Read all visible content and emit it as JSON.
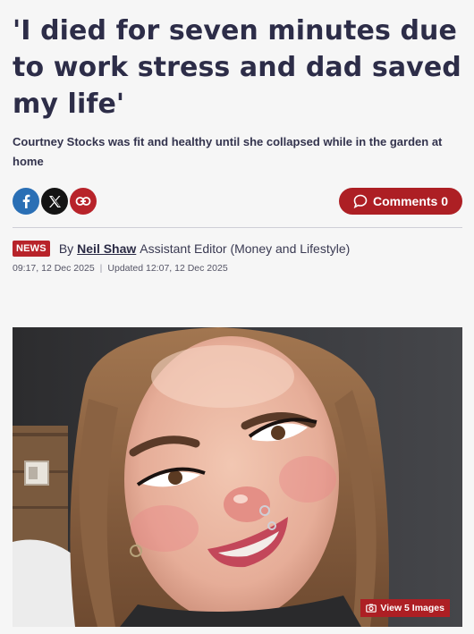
{
  "article": {
    "headline": "'I died for seven minutes due to work stress and dad saved my life'",
    "standfirst": "Courtney Stocks was fit and healthy until she collapsed while in the garden at home"
  },
  "share": {
    "facebook_icon": "facebook-icon",
    "twitter_icon": "x-icon",
    "link_icon": "link-icon"
  },
  "comments": {
    "label": "Comments 0",
    "icon": "comment-bubble-icon"
  },
  "byline": {
    "badge": "NEWS",
    "prefix": "By",
    "author": "Neil Shaw",
    "role": "Assistant Editor (Money and Lifestyle)",
    "published": "09:17, 12 Dec 2025",
    "updated": "Updated 12:07, 12 Dec 2025"
  },
  "hero": {
    "view_images_label": "View 5 Images",
    "camera_icon": "camera-icon"
  },
  "colors": {
    "brand_red": "#ad1f24",
    "facebook_blue": "#2a6fb5",
    "headline_navy": "#2d2d48"
  }
}
